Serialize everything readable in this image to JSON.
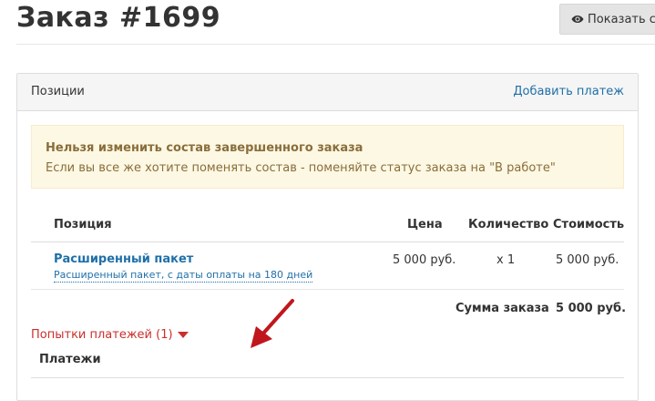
{
  "page": {
    "title": "Заказ #1699",
    "show_button_label": "Показать ст"
  },
  "panel": {
    "title": "Позиции",
    "add_payment_label": "Добавить платеж"
  },
  "alert": {
    "title": "Нельзя изменить состав завершенного заказа",
    "text": "Если вы все же хотите поменять состав - поменяйте статус заказа на \"В работе\""
  },
  "table": {
    "headers": {
      "position": "Позиция",
      "price": "Цена",
      "quantity": "Количество",
      "cost": "Стоимость"
    },
    "rows": [
      {
        "title": "Расширенный пакет",
        "description": "Расширенный пакет, с даты оплаты на 180 дней",
        "price": "5 000 руб.",
        "quantity": "x 1",
        "cost": "5 000 руб."
      }
    ],
    "total_label": "Сумма заказа",
    "total_value": "5 000 руб."
  },
  "payment_attempts": {
    "label": "Попытки платежей (1)"
  },
  "payments": {
    "title": "Платежи"
  },
  "colors": {
    "link": "#1f6fa8",
    "danger": "#c9302c",
    "alert_bg": "#fcf8e3",
    "alert_text": "#8a6d3b",
    "annotation": "#c0171c"
  },
  "icons": {
    "show_button": "eye-icon",
    "attempts_toggle": "caret-down-icon",
    "annotation": "red-arrow-icon"
  }
}
